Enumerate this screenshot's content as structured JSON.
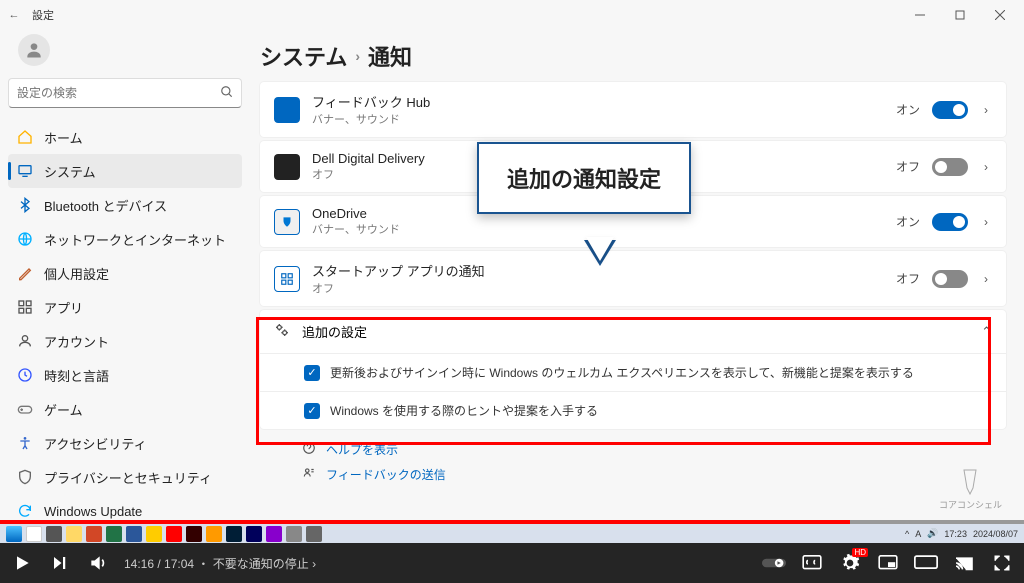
{
  "window": {
    "title": "設定"
  },
  "search": {
    "placeholder": "設定の検索"
  },
  "nav": [
    {
      "label": "ホーム",
      "icon": "home",
      "color": "#ffb300"
    },
    {
      "label": "システム",
      "icon": "system",
      "color": "#0067c0",
      "active": true
    },
    {
      "label": "Bluetooth とデバイス",
      "icon": "bluetooth",
      "color": "#0067c0"
    },
    {
      "label": "ネットワークとインターネット",
      "icon": "network",
      "color": "#00b0ff"
    },
    {
      "label": "個人用設定",
      "icon": "personal",
      "color": "#c06030"
    },
    {
      "label": "アプリ",
      "icon": "apps",
      "color": "#555"
    },
    {
      "label": "アカウント",
      "icon": "account",
      "color": "#555"
    },
    {
      "label": "時刻と言語",
      "icon": "time",
      "color": "#3355ff"
    },
    {
      "label": "ゲーム",
      "icon": "game",
      "color": "#777"
    },
    {
      "label": "アクセシビリティ",
      "icon": "accessibility",
      "color": "#3366cc"
    },
    {
      "label": "プライバシーとセキュリティ",
      "icon": "privacy",
      "color": "#666"
    },
    {
      "label": "Windows Update",
      "icon": "update",
      "color": "#00aaff"
    }
  ],
  "breadcrumb": {
    "root": "システム",
    "leaf": "通知"
  },
  "apps": [
    {
      "name": "フィードバック Hub",
      "sub": "バナー、サウンド",
      "state": "オン",
      "on": true,
      "iconColor": "#0067c0"
    },
    {
      "name": "Dell Digital Delivery",
      "sub": "オフ",
      "state": "オフ",
      "on": false,
      "iconColor": "#222"
    },
    {
      "name": "OneDrive",
      "sub": "バナー、サウンド",
      "state": "オン",
      "on": true,
      "iconColor": "#f0f0f0"
    },
    {
      "name": "スタートアップ アプリの通知",
      "sub": "オフ",
      "state": "オフ",
      "on": false,
      "iconColor": "#fff"
    }
  ],
  "additional": {
    "header": "追加の設定",
    "items": [
      "更新後およびサインイン時に Windows のウェルカム エクスペリエンスを表示して、新機能と提案を表示する",
      "Windows を使用する際のヒントや提案を入手する"
    ]
  },
  "help": {
    "show": "ヘルプを表示",
    "feedback": "フィードバックの送信"
  },
  "callout": "追加の通知設定",
  "logo": "コアコンシェル",
  "player": {
    "current": "14:16",
    "total": "17:04",
    "chapter": "不要な通知の停止"
  },
  "tray": {
    "time": "17:23",
    "date": "2024/08/07"
  }
}
